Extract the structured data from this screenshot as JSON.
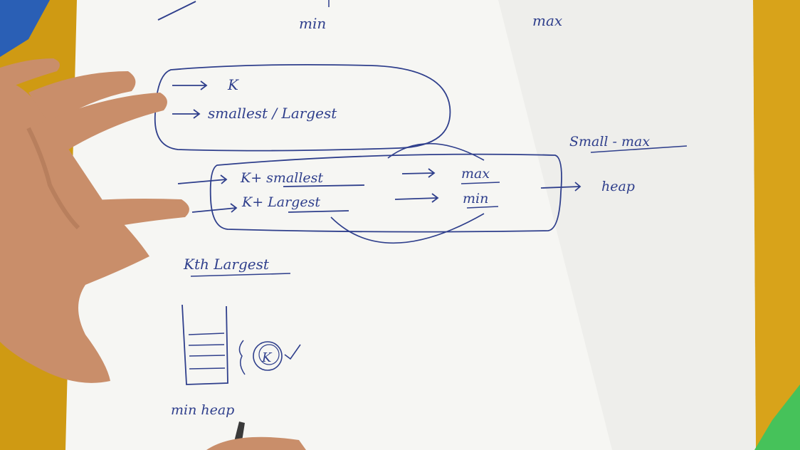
{
  "colors": {
    "table": "#d8a31a",
    "paper": "#f6f6f3",
    "ink": "#2f3f8c",
    "skin": "#c98e6a",
    "green_object": "#46c25a",
    "marker_blue": "#2a5fb5"
  },
  "notes": {
    "top_min": "min",
    "top_max": "max",
    "line_k": "K",
    "line_smallest_largest": "smallest / Largest",
    "row_k_smallest": "K+ smallest",
    "row_k_largest": "K+ Largest",
    "row_max": "max",
    "row_min": "min",
    "right_small_max": "Small - max",
    "right_heap": "heap",
    "kth_largest": "Kth Largest",
    "heap_k": "K",
    "min_heap": "min heap"
  }
}
